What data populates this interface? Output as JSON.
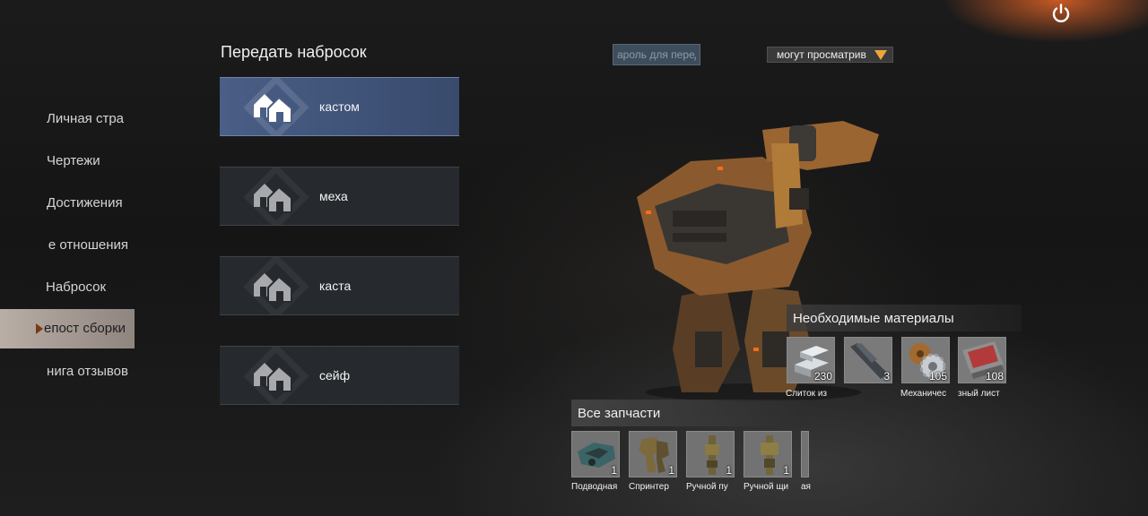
{
  "nav": {
    "items": [
      {
        "label": "Личная стра"
      },
      {
        "label": "Чертежи"
      },
      {
        "label": "Достижения"
      },
      {
        "label": "е отношения"
      },
      {
        "label": "Набросок"
      },
      {
        "label": "епост сборки"
      },
      {
        "label": "нига отзывов"
      }
    ],
    "active_index": 5
  },
  "sketch": {
    "title": "Передать набросок",
    "items": [
      {
        "label": "кастом",
        "selected": true
      },
      {
        "label": "меха",
        "selected": false
      },
      {
        "label": "каста",
        "selected": false
      },
      {
        "label": "сейф",
        "selected": false
      }
    ]
  },
  "password": {
    "placeholder": "ароль для перед"
  },
  "visibility": {
    "selected": "могут просматрив"
  },
  "materials": {
    "title": "Необходимые материалы",
    "items": [
      {
        "name": "Слиток из",
        "count": "230",
        "icon": "ingot-icon"
      },
      {
        "name": "",
        "count": "3",
        "icon": "rod-icon"
      },
      {
        "name": "Механичес",
        "count": "105",
        "icon": "gear-mechanism-icon"
      },
      {
        "name": "зный лист",
        "count": "108",
        "icon": "sheet-icon"
      }
    ]
  },
  "parts": {
    "title": "Все запчасти",
    "items": [
      {
        "name": "Подводная",
        "count": "1",
        "icon": "underwater-part-icon"
      },
      {
        "name": "Спринтер",
        "count": "1",
        "icon": "sprinter-legs-icon"
      },
      {
        "name": "Ручной пу",
        "count": "1",
        "icon": "hand-gun-icon"
      },
      {
        "name": "Ручной щи",
        "count": "1",
        "icon": "hand-shield-icon"
      },
      {
        "name": "ая",
        "count": "",
        "icon": "partial-part-icon"
      }
    ]
  },
  "colors": {
    "accent": "#f0a437",
    "selected_item": "#4a5e86",
    "active_nav": "#b9aea6"
  }
}
